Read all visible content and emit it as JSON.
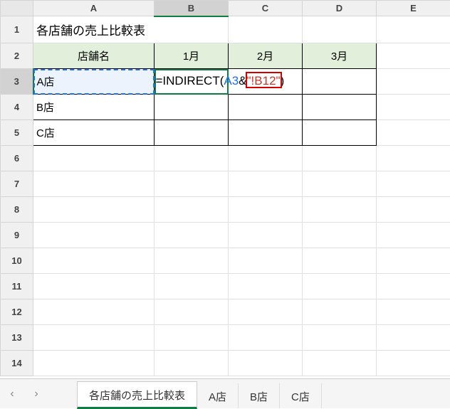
{
  "columns": [
    "A",
    "B",
    "C",
    "D",
    "E"
  ],
  "rows": [
    "1",
    "2",
    "3",
    "4",
    "5",
    "6",
    "7",
    "8",
    "9",
    "10",
    "11",
    "12",
    "13",
    "14"
  ],
  "active_column": "B",
  "active_row": "3",
  "title": "各店舗の売上比較表",
  "header_row": {
    "store": "店舗名",
    "m1": "1月",
    "m2": "2月",
    "m3": "3月"
  },
  "stores": {
    "A3": "A店",
    "A4": "B店",
    "A5": "C店"
  },
  "formula": {
    "prefix": "=INDIRECT(",
    "ref": "A3",
    "amp": "&",
    "string": "\"!B12\"",
    "suffix": ")"
  },
  "sheet_tabs": {
    "prev": "‹",
    "next": "›",
    "items": [
      "各店舗の売上比較表",
      "A店",
      "B店",
      "C店"
    ],
    "active": "各店舗の売上比較表"
  },
  "chart_data": {
    "type": "table",
    "title": "各店舗の売上比較表",
    "columns": [
      "店舗名",
      "1月",
      "2月",
      "3月"
    ],
    "rows": [
      {
        "店舗名": "A店",
        "1月": "=INDIRECT(A3&\"!B12\")",
        "2月": "",
        "3月": ""
      },
      {
        "店舗名": "B店",
        "1月": "",
        "2月": "",
        "3月": ""
      },
      {
        "店舗名": "C店",
        "1月": "",
        "2月": "",
        "3月": ""
      }
    ]
  }
}
